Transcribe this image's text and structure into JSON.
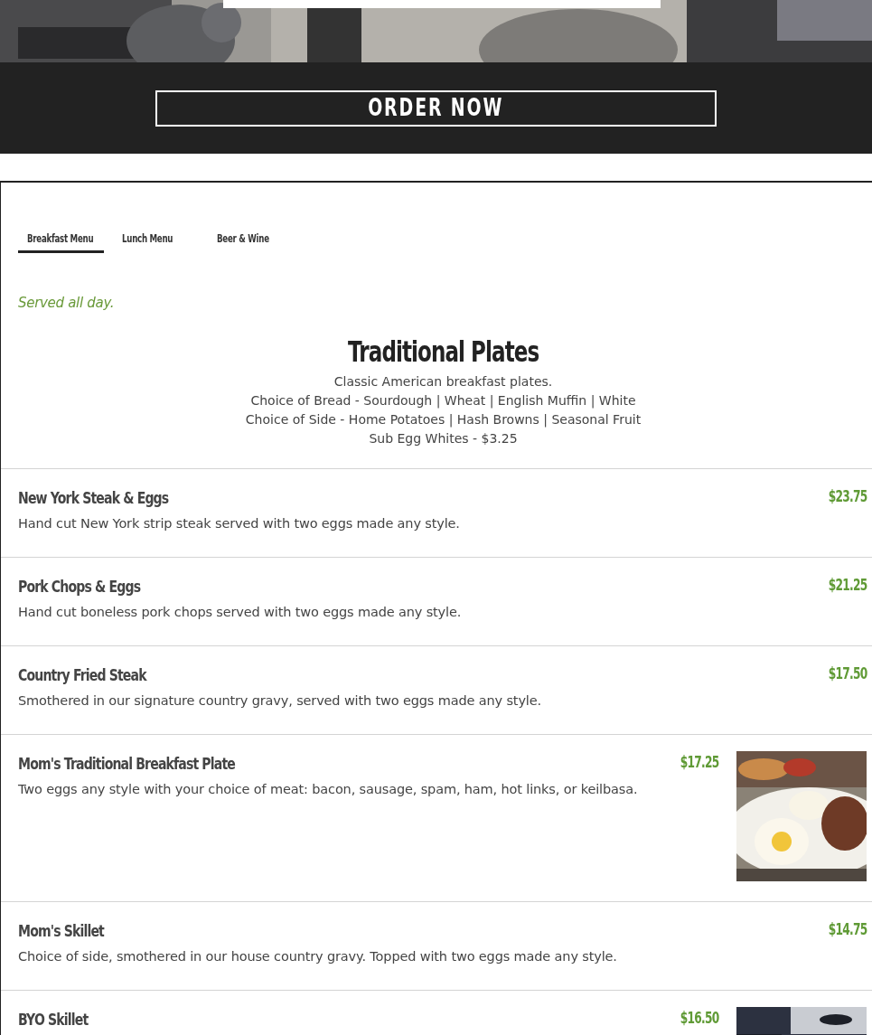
{
  "order_button": {
    "label": "ORDER NOW"
  },
  "tabs": [
    {
      "label": "Breakfast Menu",
      "selected": true
    },
    {
      "label": "Lunch Menu",
      "selected": false
    },
    {
      "label": "Beer & Wine",
      "selected": false
    }
  ],
  "note": "Served all day.",
  "section": {
    "title": "Traditional Plates",
    "lines": [
      "Classic American breakfast plates.",
      "Choice of Bread - Sourdough | Wheat | English Muffin | White",
      "Choice of Side - Home Potatoes | Hash Browns | Seasonal Fruit",
      "Sub Egg Whites - $3.25"
    ]
  },
  "items": [
    {
      "name": "New York Steak & Eggs",
      "price": "$23.75",
      "description": "Hand cut New York strip steak served with two eggs made any style."
    },
    {
      "name": "Pork Chops & Eggs",
      "price": "$21.25",
      "description": "Hand cut boneless pork chops served with two eggs made any style."
    },
    {
      "name": "Country Fried Steak",
      "price": "$17.50",
      "description": "Smothered in our signature country gravy, served with two eggs made any style."
    },
    {
      "name": "Mom's Traditional Breakfast Plate",
      "price": "$17.25",
      "description": "Two eggs any style with your choice of meat: bacon, sausage, spam, ham, hot links, or keilbasa."
    },
    {
      "name": "Mom's Skillet",
      "price": "$14.75",
      "description": "Choice of side, smothered in our house country gravy. Topped with two eggs made any style."
    },
    {
      "name": "BYO Skillet",
      "price": "$16.50"
    }
  ]
}
